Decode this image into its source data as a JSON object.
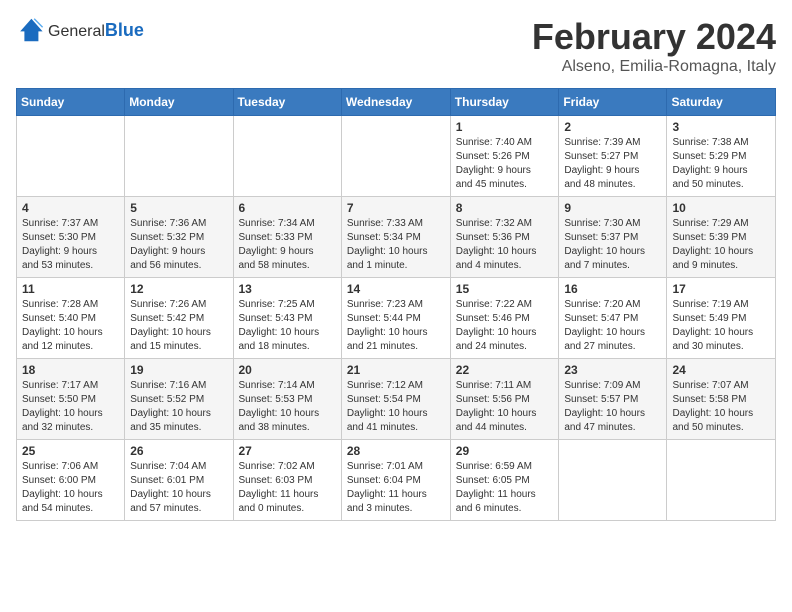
{
  "logo": {
    "general": "General",
    "blue": "Blue"
  },
  "title": "February 2024",
  "location": "Alseno, Emilia-Romagna, Italy",
  "days_of_week": [
    "Sunday",
    "Monday",
    "Tuesday",
    "Wednesday",
    "Thursday",
    "Friday",
    "Saturday"
  ],
  "weeks": [
    [
      {
        "day": "",
        "info": ""
      },
      {
        "day": "",
        "info": ""
      },
      {
        "day": "",
        "info": ""
      },
      {
        "day": "",
        "info": ""
      },
      {
        "day": "1",
        "info": "Sunrise: 7:40 AM\nSunset: 5:26 PM\nDaylight: 9 hours\nand 45 minutes."
      },
      {
        "day": "2",
        "info": "Sunrise: 7:39 AM\nSunset: 5:27 PM\nDaylight: 9 hours\nand 48 minutes."
      },
      {
        "day": "3",
        "info": "Sunrise: 7:38 AM\nSunset: 5:29 PM\nDaylight: 9 hours\nand 50 minutes."
      }
    ],
    [
      {
        "day": "4",
        "info": "Sunrise: 7:37 AM\nSunset: 5:30 PM\nDaylight: 9 hours\nand 53 minutes."
      },
      {
        "day": "5",
        "info": "Sunrise: 7:36 AM\nSunset: 5:32 PM\nDaylight: 9 hours\nand 56 minutes."
      },
      {
        "day": "6",
        "info": "Sunrise: 7:34 AM\nSunset: 5:33 PM\nDaylight: 9 hours\nand 58 minutes."
      },
      {
        "day": "7",
        "info": "Sunrise: 7:33 AM\nSunset: 5:34 PM\nDaylight: 10 hours\nand 1 minute."
      },
      {
        "day": "8",
        "info": "Sunrise: 7:32 AM\nSunset: 5:36 PM\nDaylight: 10 hours\nand 4 minutes."
      },
      {
        "day": "9",
        "info": "Sunrise: 7:30 AM\nSunset: 5:37 PM\nDaylight: 10 hours\nand 7 minutes."
      },
      {
        "day": "10",
        "info": "Sunrise: 7:29 AM\nSunset: 5:39 PM\nDaylight: 10 hours\nand 9 minutes."
      }
    ],
    [
      {
        "day": "11",
        "info": "Sunrise: 7:28 AM\nSunset: 5:40 PM\nDaylight: 10 hours\nand 12 minutes."
      },
      {
        "day": "12",
        "info": "Sunrise: 7:26 AM\nSunset: 5:42 PM\nDaylight: 10 hours\nand 15 minutes."
      },
      {
        "day": "13",
        "info": "Sunrise: 7:25 AM\nSunset: 5:43 PM\nDaylight: 10 hours\nand 18 minutes."
      },
      {
        "day": "14",
        "info": "Sunrise: 7:23 AM\nSunset: 5:44 PM\nDaylight: 10 hours\nand 21 minutes."
      },
      {
        "day": "15",
        "info": "Sunrise: 7:22 AM\nSunset: 5:46 PM\nDaylight: 10 hours\nand 24 minutes."
      },
      {
        "day": "16",
        "info": "Sunrise: 7:20 AM\nSunset: 5:47 PM\nDaylight: 10 hours\nand 27 minutes."
      },
      {
        "day": "17",
        "info": "Sunrise: 7:19 AM\nSunset: 5:49 PM\nDaylight: 10 hours\nand 30 minutes."
      }
    ],
    [
      {
        "day": "18",
        "info": "Sunrise: 7:17 AM\nSunset: 5:50 PM\nDaylight: 10 hours\nand 32 minutes."
      },
      {
        "day": "19",
        "info": "Sunrise: 7:16 AM\nSunset: 5:52 PM\nDaylight: 10 hours\nand 35 minutes."
      },
      {
        "day": "20",
        "info": "Sunrise: 7:14 AM\nSunset: 5:53 PM\nDaylight: 10 hours\nand 38 minutes."
      },
      {
        "day": "21",
        "info": "Sunrise: 7:12 AM\nSunset: 5:54 PM\nDaylight: 10 hours\nand 41 minutes."
      },
      {
        "day": "22",
        "info": "Sunrise: 7:11 AM\nSunset: 5:56 PM\nDaylight: 10 hours\nand 44 minutes."
      },
      {
        "day": "23",
        "info": "Sunrise: 7:09 AM\nSunset: 5:57 PM\nDaylight: 10 hours\nand 47 minutes."
      },
      {
        "day": "24",
        "info": "Sunrise: 7:07 AM\nSunset: 5:58 PM\nDaylight: 10 hours\nand 50 minutes."
      }
    ],
    [
      {
        "day": "25",
        "info": "Sunrise: 7:06 AM\nSunset: 6:00 PM\nDaylight: 10 hours\nand 54 minutes."
      },
      {
        "day": "26",
        "info": "Sunrise: 7:04 AM\nSunset: 6:01 PM\nDaylight: 10 hours\nand 57 minutes."
      },
      {
        "day": "27",
        "info": "Sunrise: 7:02 AM\nSunset: 6:03 PM\nDaylight: 11 hours\nand 0 minutes."
      },
      {
        "day": "28",
        "info": "Sunrise: 7:01 AM\nSunset: 6:04 PM\nDaylight: 11 hours\nand 3 minutes."
      },
      {
        "day": "29",
        "info": "Sunrise: 6:59 AM\nSunset: 6:05 PM\nDaylight: 11 hours\nand 6 minutes."
      },
      {
        "day": "",
        "info": ""
      },
      {
        "day": "",
        "info": ""
      }
    ]
  ]
}
